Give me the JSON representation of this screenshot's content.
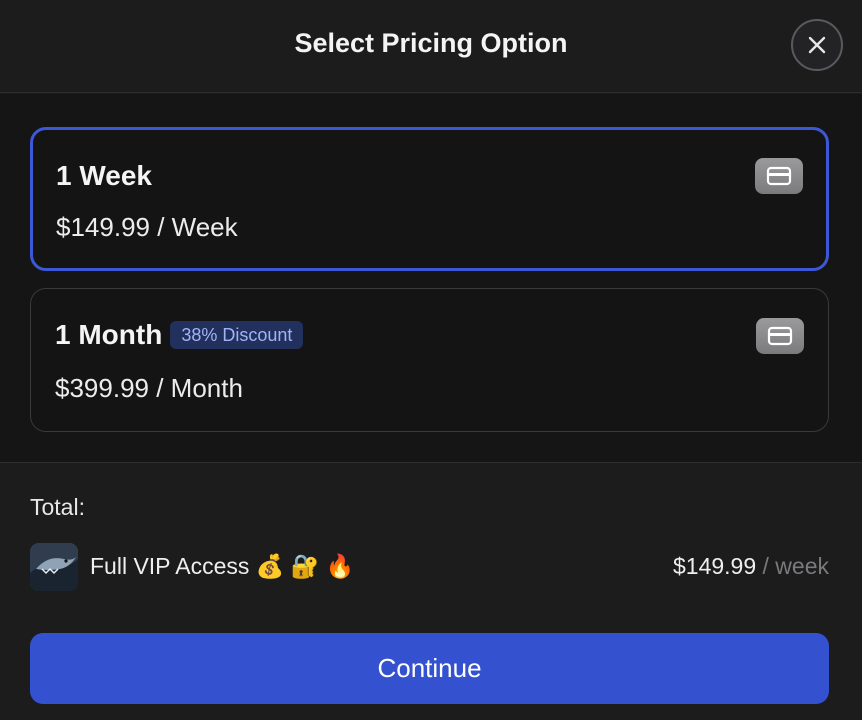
{
  "header": {
    "title": "Select Pricing Option",
    "close_icon": "close-icon"
  },
  "options": [
    {
      "name": "1 Week",
      "price": "$149.99 / Week",
      "selected": true,
      "icon": "credit-card-icon"
    },
    {
      "name": "1 Month",
      "badge": "38% Discount",
      "price": "$399.99 / Month",
      "selected": false,
      "icon": "credit-card-icon"
    }
  ],
  "summary": {
    "label": "Total:",
    "product_name": "Full VIP Access 💰 🔐 🔥",
    "price": "$149.99",
    "unit": " / week"
  },
  "continue_label": "Continue",
  "colors": {
    "accent": "#3452d0",
    "selected_border": "#3d58d6",
    "badge_bg": "#22305e",
    "badge_text": "#9fb4f5"
  }
}
